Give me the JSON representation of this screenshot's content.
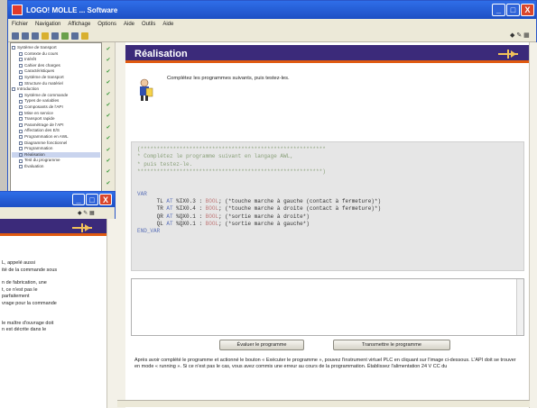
{
  "window": {
    "title": "LOGO! MOLLE ... Software",
    "minimize": "_",
    "maximize": "□",
    "close": "X"
  },
  "menu": [
    "Fichier",
    "Navigation",
    "Affichage",
    "Options",
    "Aide",
    "Outils",
    "Aide"
  ],
  "tree": {
    "items": [
      "Système de transport",
      "Contexte du cours",
      "Intérêt",
      "Cahier des charges",
      "Caractéristiques",
      "Système de transport",
      "Structure du matériel",
      "Introduction",
      "Système de commande",
      "Types de variables",
      "Composants de l'API",
      "Mise en service",
      "Transport rapide",
      "Paramétrage de l'API",
      "Affectation des E/S",
      "Programmation en AWL",
      "Diagramme fonctionnel",
      "Programmation",
      "Réalisation",
      "Test du programme",
      "Évaluation"
    ]
  },
  "content": {
    "title": "Réalisation",
    "instruction": "Complétez les programmes suivants, puis testez-les.",
    "code": {
      "comment1": "(*********************************************************",
      "comment2": "* Complétez le programme suivant en langage AWL,",
      "comment3": "* puis testez-le.",
      "comment4": "*********************************************************)",
      "var_kw": "VAR",
      "lines": [
        {
          "name": "TL",
          "addr": "%IX0.3",
          "type": "BOOL",
          "comment": "(*touche marche à gauche (contact à fermeture)*)"
        },
        {
          "name": "TR",
          "addr": "%IX0.4",
          "type": "BOOL",
          "comment": "(*touche marche à droite (contact à fermeture)*)"
        },
        {
          "name": "QR",
          "addr": "%QX0.1",
          "type": "BOOL",
          "comment": "(*sortie marche à droite*)"
        },
        {
          "name": "QL",
          "addr": "%QX0.1",
          "type": "BOOL",
          "comment": "(*sortie marche à gauche*)"
        }
      ],
      "end_var": "END_VAR",
      "at": "AT"
    },
    "button_evaluate": "Évaluer le programme",
    "button_transfer": "Transmettre le programme",
    "after_text": "Après avoir complété le programme et actionné le bouton « Exécuter le programme », pouvez l'instrument virtuel PLC en cliquant sur l'image ci-dessous. L'API doit se trouver en mode « running ». Si ce n'est pas le cas, vous avez commis une erreur au cours de la programmation. Établissez l'alimentation 24 V CC du"
  },
  "secondary": {
    "text": [
      "L, appelé aussi",
      "ité de la commande sous",
      "",
      "n de fabrication, une",
      "t, ce n'est pas le",
      "parfaitement",
      "vrage pour la commande",
      "",
      "",
      "le maître d'ouvrage doit",
      "n est décrite dans le"
    ]
  },
  "colors": {
    "titlebar": "#1d4fc4",
    "header": "#3b2a7a",
    "accent": "#e05a10"
  }
}
